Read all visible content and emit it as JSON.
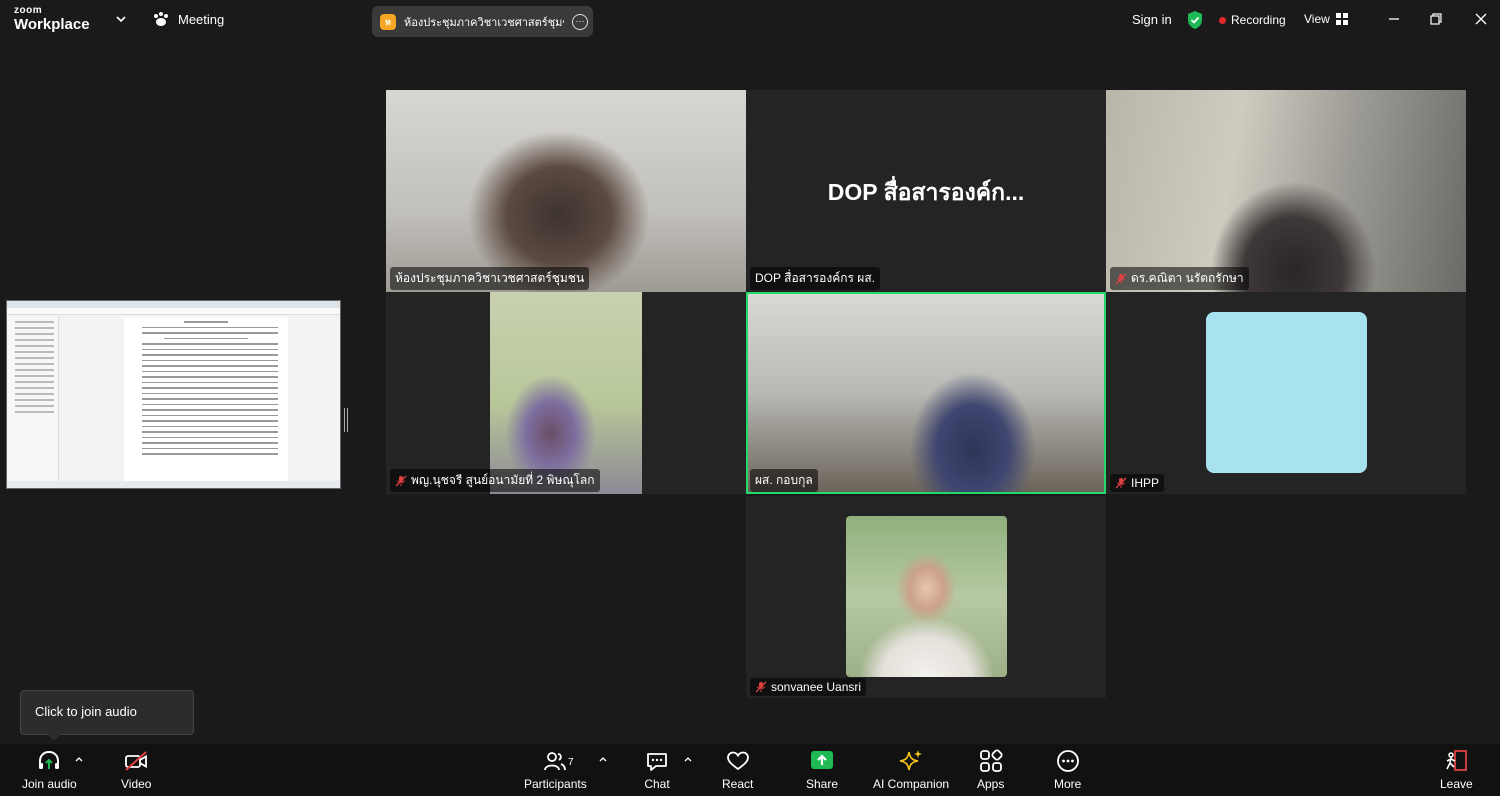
{
  "topbar": {
    "logo_top": "zoom",
    "logo_bottom": "Workplace",
    "meeting_label": "Meeting",
    "chip_avatar": "ห",
    "meeting_title": "ห้องประชุมภาควิชาเวชศาสตร์ชุมชน's s",
    "sign_in": "Sign in",
    "recording": "Recording",
    "view": "View"
  },
  "participants": [
    {
      "name": "ห้องประชุมภาควิชาเวชศาสตร์ชุมชน",
      "muted": false
    },
    {
      "name": "DOP สื่อสารองค์กร ผส.",
      "display": "DOP สื่อสารองค์ก...",
      "muted": false
    },
    {
      "name": "ดร.คณิตา นรัตถรักษา",
      "muted": true
    },
    {
      "name": "พญ.นุชจรี สูนย์อนามัยที่ 2 พิษณุโลก",
      "muted": true
    },
    {
      "name": "ผส. กอบกุล",
      "muted": false,
      "speaking": true
    },
    {
      "name": "IHPP",
      "muted": true
    },
    {
      "name": "sonvanee Uansri",
      "muted": true
    }
  ],
  "tooltip": "Click to join audio",
  "toolbar": {
    "join_audio": "Join audio",
    "video": "Video",
    "participants": "Participants",
    "participants_count": "7",
    "chat": "Chat",
    "react": "React",
    "share": "Share",
    "ai_companion": "AI Companion",
    "apps": "Apps",
    "more": "More",
    "leave": "Leave"
  },
  "colors": {
    "speaking_border": "#23d96b",
    "share_green": "#1fb955",
    "recording_red": "#e02828",
    "leave_red": "#e04040"
  }
}
